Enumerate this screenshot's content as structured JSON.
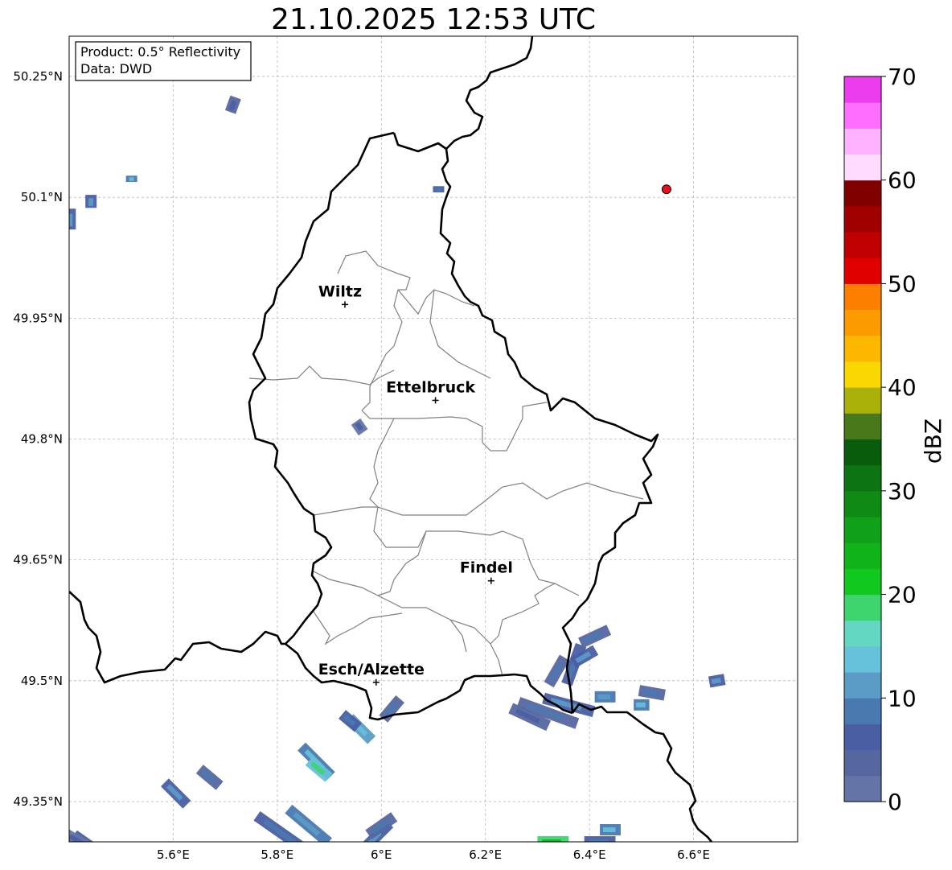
{
  "title": "21.10.2025 12:53 UTC",
  "info_box": {
    "line1": "Product: 0.5° Reflectivity",
    "line2": "Data: DWD"
  },
  "map": {
    "lon_range": [
      5.4,
      6.8
    ],
    "lat_range": [
      49.3,
      50.3
    ],
    "x_ticks": [
      {
        "value": 5.6,
        "label": "5.6°E"
      },
      {
        "value": 5.8,
        "label": "5.8°E"
      },
      {
        "value": 6.0,
        "label": "6°E"
      },
      {
        "value": 6.2,
        "label": "6.2°E"
      },
      {
        "value": 6.4,
        "label": "6.4°E"
      },
      {
        "value": 6.6,
        "label": "6.6°E"
      }
    ],
    "y_ticks": [
      {
        "value": 49.35,
        "label": "49.35°N"
      },
      {
        "value": 49.5,
        "label": "49.5°N"
      },
      {
        "value": 49.65,
        "label": "49.65°N"
      },
      {
        "value": 49.8,
        "label": "49.8°N"
      },
      {
        "value": 49.95,
        "label": "49.95°N"
      },
      {
        "value": 50.1,
        "label": "50.1°N"
      },
      {
        "value": 50.25,
        "label": "50.25°N"
      }
    ],
    "cities": [
      {
        "name": "Wiltz",
        "lon": 5.93,
        "lat": 49.967
      },
      {
        "name": "Ettelbruck",
        "lon": 6.104,
        "lat": 49.848
      },
      {
        "name": "Findel",
        "lon": 6.211,
        "lat": 49.624
      },
      {
        "name": "Esch/Alzette",
        "lon": 5.99,
        "lat": 49.498
      }
    ],
    "radar_site": {
      "lon": 6.548,
      "lat": 50.11,
      "color": "#e8101a"
    }
  },
  "colorbar": {
    "label": "dBZ",
    "min": 0,
    "max": 70,
    "ticks": [
      0,
      10,
      20,
      30,
      40,
      50,
      60,
      70
    ],
    "colors": [
      "#6474a6",
      "#5667a0",
      "#4a5ea3",
      "#4a79b0",
      "#5a9cc6",
      "#66c1da",
      "#64d7c2",
      "#3ed46e",
      "#10c81e",
      "#10b418",
      "#10a01a",
      "#0f8a14",
      "#0c7412",
      "#085c0c",
      "#48781a",
      "#aab20a",
      "#fad700",
      "#fcb800",
      "#fc9b00",
      "#fc7f00",
      "#e00000",
      "#c00000",
      "#a00000",
      "#800000",
      "#ffdcff",
      "#ffb2ff",
      "#ff6eff",
      "#ec3ced"
    ]
  },
  "precip_cells": [
    {
      "lon": 5.715,
      "lat": 50.215,
      "len": 0.03,
      "ang": -70,
      "dbz": 3
    },
    {
      "lon": 5.52,
      "lat": 50.123,
      "len": 0.012,
      "ang": -90,
      "dbz": 9
    },
    {
      "lon": 5.442,
      "lat": 50.095,
      "len": 0.025,
      "ang": -90,
      "dbz": 7
    },
    {
      "lon": 5.402,
      "lat": 50.073,
      "len": 0.04,
      "ang": -90,
      "dbz": 6
    },
    {
      "lon": 6.11,
      "lat": 50.11,
      "len": 0.012,
      "ang": -90,
      "dbz": 5
    },
    {
      "lon": 5.958,
      "lat": 49.815,
      "len": 0.025,
      "ang": 55,
      "dbz": 2
    },
    {
      "lon": 6.337,
      "lat": 49.512,
      "len": 0.06,
      "ang": -60,
      "dbz": 4
    },
    {
      "lon": 6.37,
      "lat": 49.52,
      "len": 0.08,
      "ang": -70,
      "dbz": 5
    },
    {
      "lon": 6.39,
      "lat": 49.53,
      "len": 0.05,
      "ang": -30,
      "dbz": 7
    },
    {
      "lon": 6.41,
      "lat": 49.555,
      "len": 0.06,
      "ang": -25,
      "dbz": 4
    },
    {
      "lon": 6.32,
      "lat": 49.46,
      "len": 0.12,
      "ang": 20,
      "dbz": 4
    },
    {
      "lon": 6.36,
      "lat": 49.47,
      "len": 0.1,
      "ang": 15,
      "dbz": 6
    },
    {
      "lon": 6.285,
      "lat": 49.455,
      "len": 0.08,
      "ang": 25,
      "dbz": 3
    },
    {
      "lon": 6.43,
      "lat": 49.48,
      "len": 0.04,
      "ang": 0,
      "dbz": 8
    },
    {
      "lon": 6.52,
      "lat": 49.485,
      "len": 0.05,
      "ang": 10,
      "dbz": 4
    },
    {
      "lon": 6.5,
      "lat": 49.47,
      "len": 0.03,
      "ang": 0,
      "dbz": 9
    },
    {
      "lon": 6.645,
      "lat": 49.5,
      "len": 0.03,
      "ang": -10,
      "dbz": 6
    },
    {
      "lon": 6.02,
      "lat": 49.465,
      "len": 0.05,
      "ang": -50,
      "dbz": 4
    },
    {
      "lon": 5.96,
      "lat": 49.44,
      "len": 0.06,
      "ang": 45,
      "dbz": 10
    },
    {
      "lon": 5.94,
      "lat": 49.45,
      "len": 0.04,
      "ang": 40,
      "dbz": 5
    },
    {
      "lon": 5.875,
      "lat": 49.4,
      "len": 0.08,
      "ang": 45,
      "dbz": 9
    },
    {
      "lon": 5.88,
      "lat": 49.39,
      "len": 0.05,
      "ang": 40,
      "dbz": 14
    },
    {
      "lon": 5.67,
      "lat": 49.38,
      "len": 0.05,
      "ang": 40,
      "dbz": 4
    },
    {
      "lon": 5.605,
      "lat": 49.36,
      "len": 0.06,
      "ang": 45,
      "dbz": 7
    },
    {
      "lon": 5.81,
      "lat": 49.31,
      "len": 0.12,
      "ang": 35,
      "dbz": 5
    },
    {
      "lon": 5.86,
      "lat": 49.32,
      "len": 0.1,
      "ang": 40,
      "dbz": 8
    },
    {
      "lon": 5.73,
      "lat": 49.28,
      "len": 0.08,
      "ang": 30,
      "dbz": 3
    },
    {
      "lon": 5.98,
      "lat": 49.3,
      "len": 0.1,
      "ang": -45,
      "dbz": 6
    },
    {
      "lon": 6.0,
      "lat": 49.32,
      "len": 0.06,
      "ang": -35,
      "dbz": 4
    },
    {
      "lon": 5.45,
      "lat": 49.29,
      "len": 0.1,
      "ang": 35,
      "dbz": 7
    },
    {
      "lon": 5.42,
      "lat": 49.3,
      "len": 0.06,
      "ang": 30,
      "dbz": 2
    },
    {
      "lon": 6.33,
      "lat": 49.3,
      "len": 0.06,
      "ang": 0,
      "dbz": 19
    },
    {
      "lon": 6.42,
      "lat": 49.3,
      "len": 0.06,
      "ang": 0,
      "dbz": 5
    },
    {
      "lon": 6.44,
      "lat": 49.315,
      "len": 0.04,
      "ang": 0,
      "dbz": 9
    }
  ]
}
